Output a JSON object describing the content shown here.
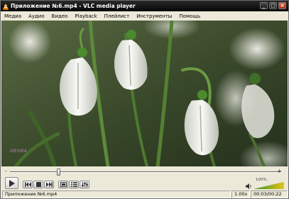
{
  "window": {
    "title": "Приложение №6.mp4 - VLC media player"
  },
  "title_buttons": {
    "minimize": "_",
    "maximize": "□",
    "close": "×"
  },
  "menu": [
    "Медиа",
    "Аудио",
    "Видео",
    "Playback",
    "Плейлист",
    "Инструменты",
    "Помощь"
  ],
  "video": {
    "watermark": "VIEVIRA"
  },
  "seek": {
    "minus": "-",
    "plus": "+",
    "position_fraction": 0.18
  },
  "controls": {
    "play": "play-icon",
    "prev": "prev-icon",
    "stop": "stop-icon",
    "next": "next-icon",
    "fullscreen": "fullscreen-icon",
    "playlist": "playlist-icon",
    "extended": "extended-settings-icon"
  },
  "volume": {
    "label": "100%",
    "level_fraction": 1.0
  },
  "status": {
    "filename": "Приложение №6.mp4",
    "speed": "1.00x",
    "time": "00:03/00:22"
  },
  "colors": {
    "titlebar": "#0d0d0d",
    "chrome": "#ece9d8",
    "volume_start": "#2f9a1f",
    "volume_end": "#e8c21a"
  }
}
